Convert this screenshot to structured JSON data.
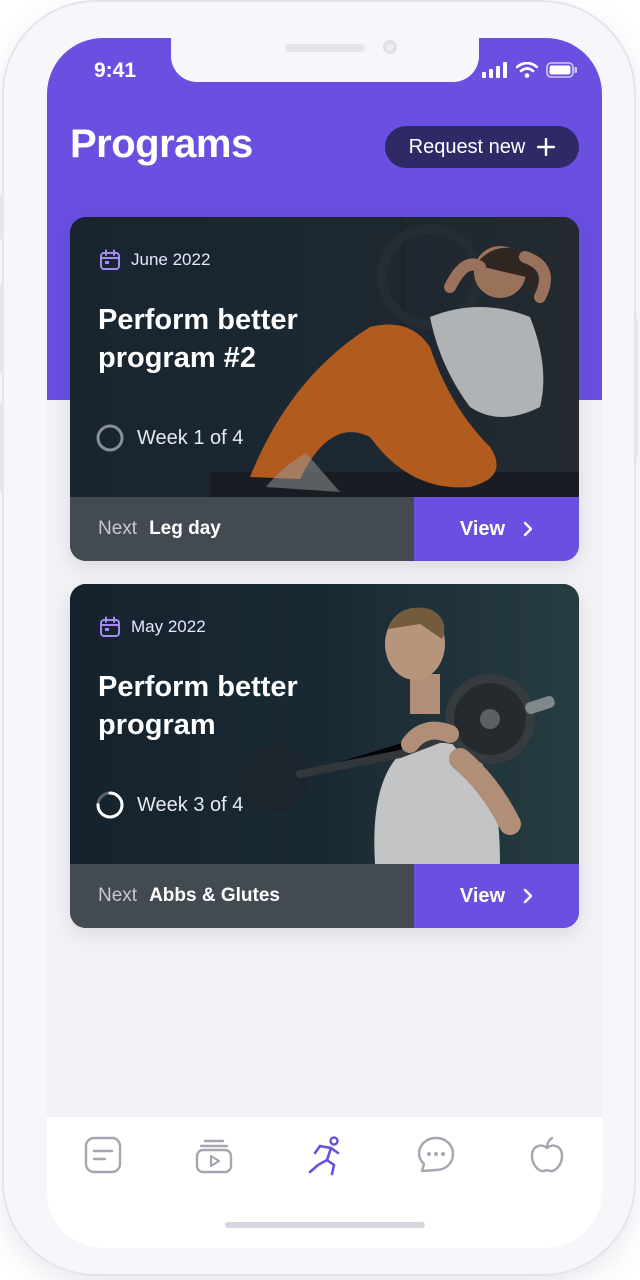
{
  "status_bar": {
    "time": "9:41",
    "signal_icon": "signal-bars-icon",
    "wifi_icon": "wifi-icon",
    "battery_icon": "battery-icon"
  },
  "header": {
    "title": "Programs",
    "request_button_label": "Request new",
    "request_button_icon": "plus-icon"
  },
  "programs": [
    {
      "date": "June 2022",
      "title": "Perform better program #2",
      "week": "Week 1 of 4",
      "progress": 0.0,
      "next_label": "Next",
      "next_value": "Leg day",
      "view_label": "View"
    },
    {
      "date": "May 2022",
      "title": "Perform better program",
      "week": "Week 3 of 4",
      "progress": 0.75,
      "next_label": "Next",
      "next_value": "Abbs & Glutes",
      "view_label": "View"
    }
  ],
  "tab_bar": [
    {
      "icon": "notes-icon",
      "active": false
    },
    {
      "icon": "video-library-icon",
      "active": false
    },
    {
      "icon": "workout-icon",
      "active": true
    },
    {
      "icon": "chat-icon",
      "active": false
    },
    {
      "icon": "nutrition-apple-icon",
      "active": false
    }
  ],
  "colors": {
    "accent": "#6a4fe0",
    "accent_dark": "#2f2a66",
    "footer_gray": "#444a52",
    "tab_inactive": "#a6a6b0"
  }
}
